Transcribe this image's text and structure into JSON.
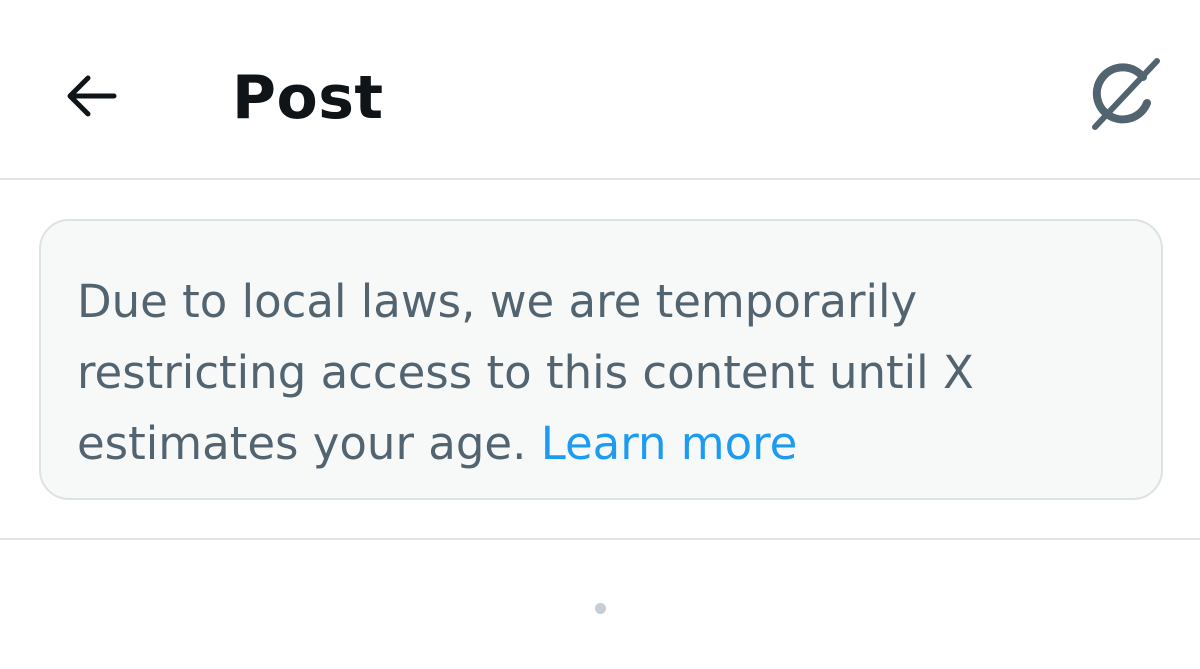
{
  "header": {
    "title": "Post",
    "back_icon": "arrow-left-icon",
    "grok_icon": "grok-icon"
  },
  "notice": {
    "text": "Due to local laws, we are temporarily restricting access to this content until X estimates your age.",
    "link_label": "Learn more"
  },
  "colors": {
    "text_primary": "#0f1419",
    "text_secondary": "#536471",
    "link": "#1d9bf0",
    "notice_bg": "#f7f9f9",
    "border": "#e1e5e8"
  }
}
